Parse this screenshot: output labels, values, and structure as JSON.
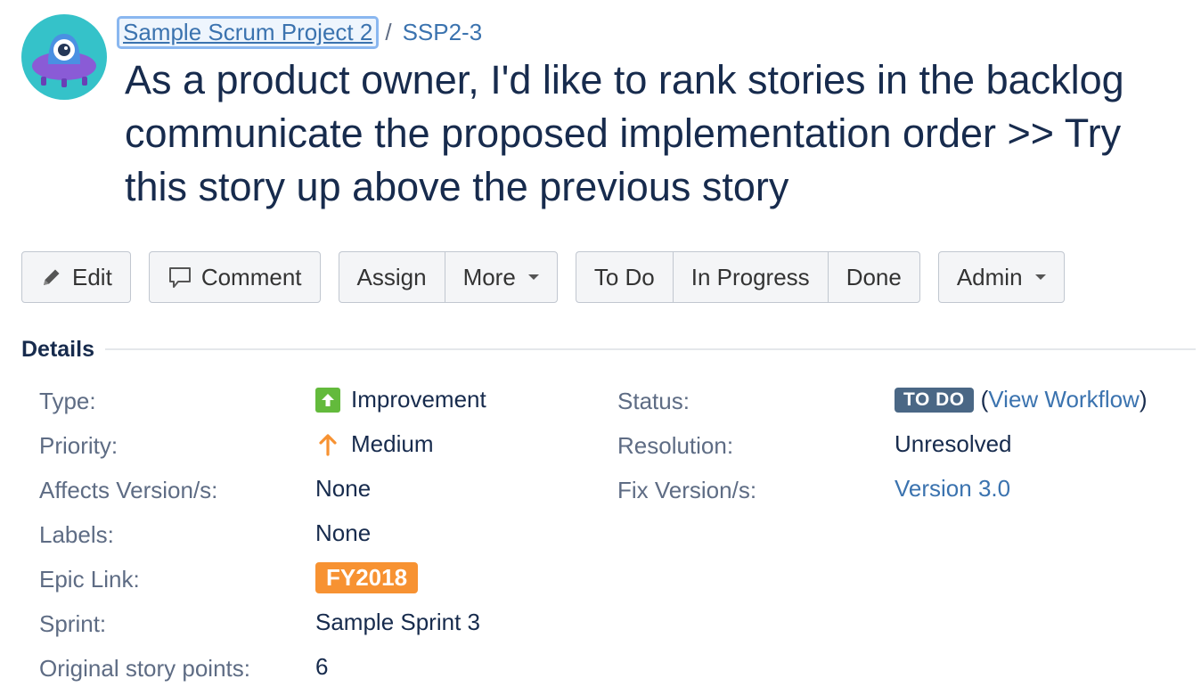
{
  "breadcrumb": {
    "project": "Sample Scrum Project 2",
    "separator": "/",
    "issue_key": "SSP2-3"
  },
  "issue": {
    "title_lines": [
      "As a product owner, I'd like to rank stories in the backlog",
      "communicate the proposed implementation order >> Try",
      "this story up above the previous story"
    ]
  },
  "toolbar": {
    "edit": "Edit",
    "comment": "Comment",
    "assign": "Assign",
    "more": "More",
    "todo": "To Do",
    "in_progress": "In Progress",
    "done": "Done",
    "admin": "Admin"
  },
  "details": {
    "heading": "Details",
    "left": [
      {
        "label": "Type:",
        "value": "Improvement"
      },
      {
        "label": "Priority:",
        "value": "Medium"
      },
      {
        "label": "Affects Version/s:",
        "value": "None"
      },
      {
        "label": "Labels:",
        "value": "None"
      },
      {
        "label": "Epic Link:",
        "value": "FY2018"
      },
      {
        "label": "Sprint:",
        "value": "Sample Sprint 3"
      },
      {
        "label": "Original story points:",
        "value": "6"
      }
    ],
    "right": {
      "status_label": "Status:",
      "status_value": "TO DO",
      "workflow_open": "(",
      "workflow_link": "View Workflow",
      "workflow_close": ")",
      "resolution_label": "Resolution:",
      "resolution_value": "Unresolved",
      "fix_label": "Fix Version/s:",
      "fix_value": "Version 3.0"
    }
  },
  "colors": {
    "link": "#3b73af",
    "status_lozenge": "#4a6785",
    "epic": "#f79232",
    "improvement_icon": "#63ba3c",
    "priority_medium": "#f79232"
  },
  "icons": {
    "avatar": "project-avatar-icon",
    "edit": "pencil-icon",
    "comment": "speech-bubble-icon",
    "type": "improvement-arrow-up-icon",
    "priority": "medium-priority-arrow-icon"
  }
}
